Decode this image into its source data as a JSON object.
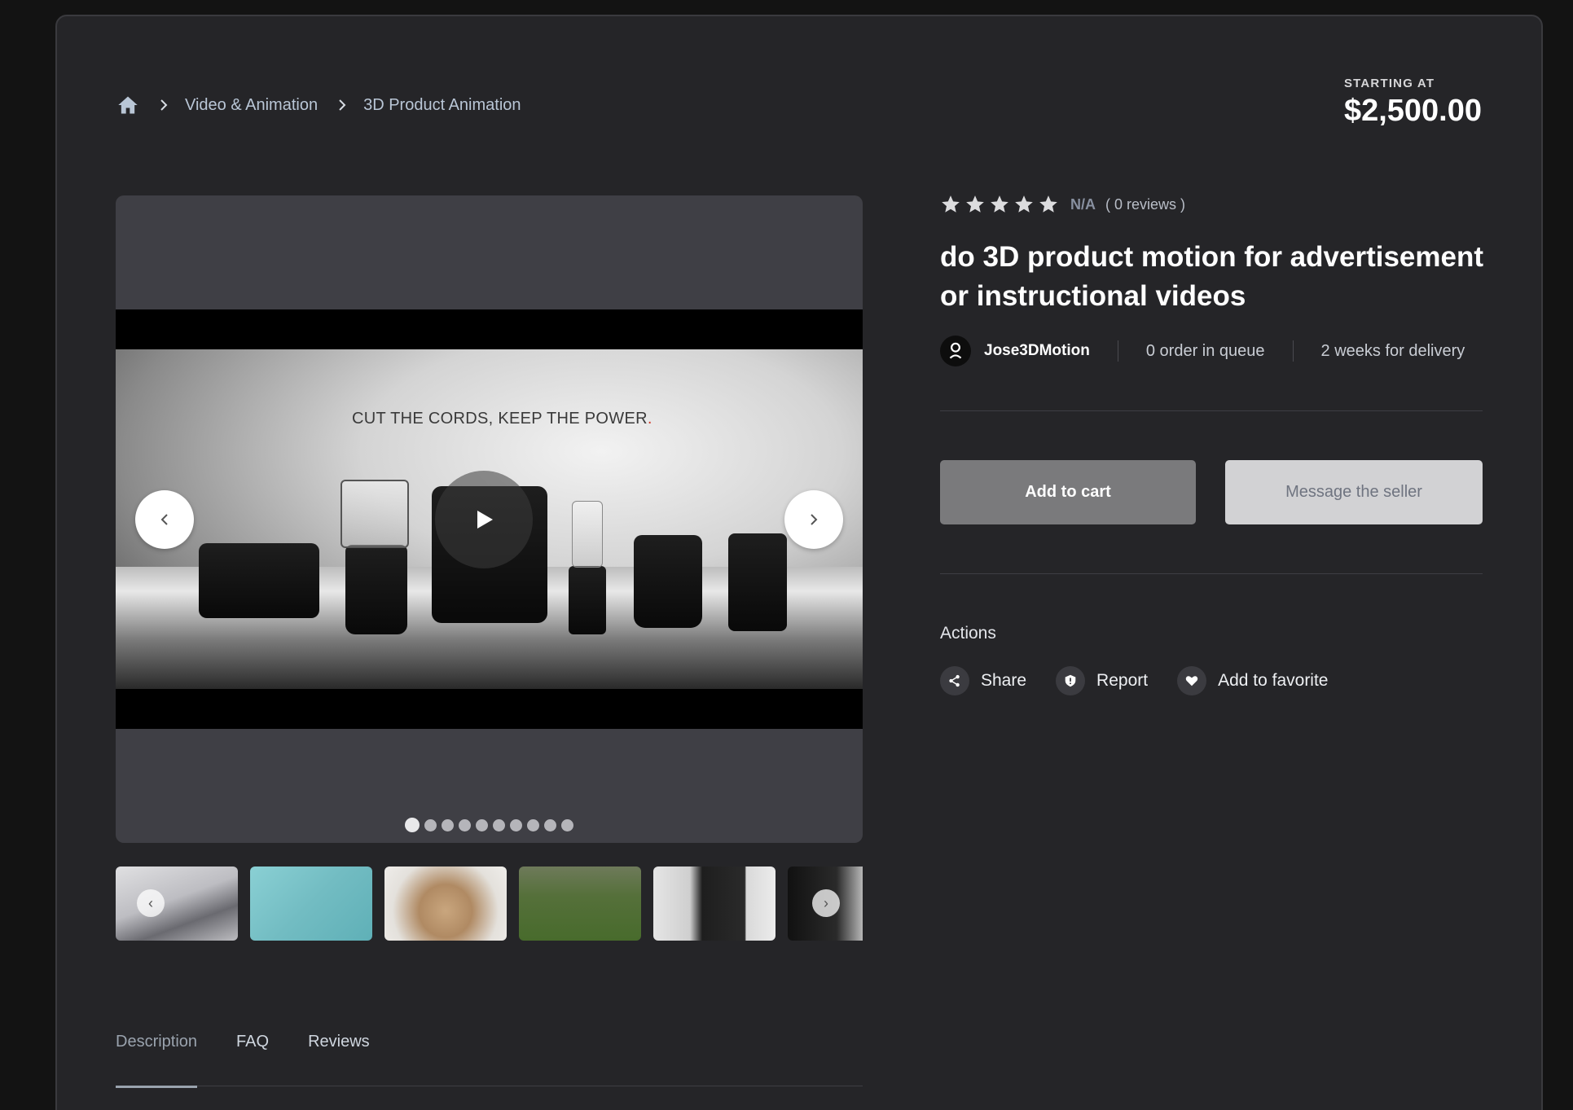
{
  "breadcrumb": {
    "home_icon": "home-icon",
    "items": [
      {
        "label": "Video & Animation"
      },
      {
        "label": "3D Product Animation"
      }
    ]
  },
  "pricing": {
    "label": "STARTING AT",
    "value": "$2,500.00"
  },
  "media": {
    "tagline": "CUT THE CORDS, KEEP THE POWER",
    "tagline_dot": ".",
    "slide_count": 10,
    "active_slide": 1,
    "thumbnails": [
      "gear-assembly",
      "exploded-parts",
      "headphones",
      "soccer-goal",
      "black-appliance",
      "appliance-closeup"
    ]
  },
  "rating": {
    "stars": 5,
    "score": "N/A",
    "count_text": "( 0 reviews )"
  },
  "gig": {
    "title": "do 3D product motion for advertisement or instructional videos"
  },
  "seller": {
    "name": "Jose3DMotion",
    "queue": "0 order in queue",
    "delivery": "2 weeks for delivery"
  },
  "buttons": {
    "add_to_cart": "Add to cart",
    "message_seller": "Message the seller"
  },
  "actions": {
    "heading": "Actions",
    "share": "Share",
    "report": "Report",
    "favorite": "Add to favorite"
  },
  "tabs": [
    {
      "label": "Description",
      "active": true
    },
    {
      "label": "FAQ",
      "active": false
    },
    {
      "label": "Reviews",
      "active": false
    }
  ],
  "colors": {
    "background": "#131313",
    "panel": "#252528",
    "add_to_cart_bg": "#7a7a7c",
    "message_bg": "#d2d2d4",
    "breadcrumb_text": "#b9c6d6"
  }
}
